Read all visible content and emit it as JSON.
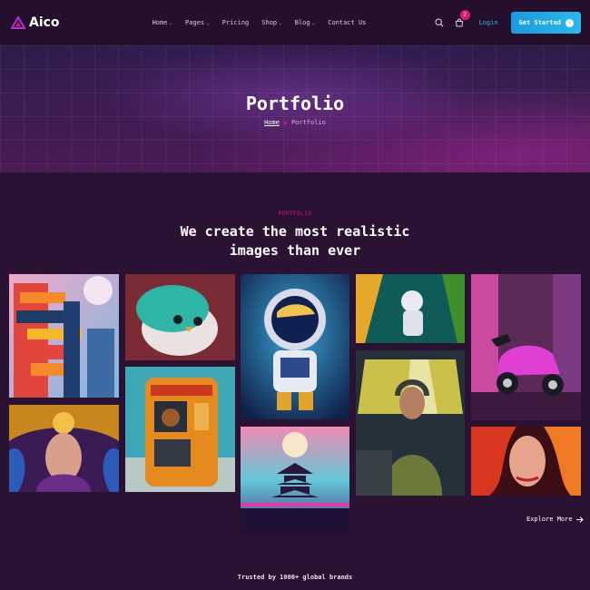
{
  "brand": {
    "name": "Aico"
  },
  "nav": {
    "items": [
      {
        "label": "Home",
        "has_dropdown": true
      },
      {
        "label": "Pages",
        "has_dropdown": true
      },
      {
        "label": "Pricing",
        "has_dropdown": false
      },
      {
        "label": "Shop",
        "has_dropdown": true
      },
      {
        "label": "Blog",
        "has_dropdown": true
      },
      {
        "label": "Contact Us",
        "has_dropdown": false
      }
    ]
  },
  "header": {
    "cart_count": "2",
    "login_label": "Login",
    "cta_label": "Get Started",
    "icons": [
      "search-icon",
      "cart-icon",
      "arrow-right-icon"
    ]
  },
  "hero": {
    "title": "Portfolio",
    "breadcrumb": {
      "home": "Home",
      "current": "Portfolio"
    }
  },
  "portfolio": {
    "eyebrow": "PORTFOLIO",
    "title": "We create the most realistic images than ever",
    "images": [
      "robot-building-illustration",
      "fluffy-bird-creature",
      "astronaut-toy-character",
      "astronaut-in-jungle",
      "pink-scooter",
      "golden-mask-woman-portrait",
      "teddy-bear-vending-machine",
      "pilot-woman-in-cockpit",
      "neon-pagoda-landscape",
      "fire-haired-woman-portrait"
    ],
    "explore_label": "Explore More"
  },
  "brands": {
    "trusted_label": "Trusted by 1000+ global brands"
  },
  "colors": {
    "accent_pink": "#e0157a",
    "accent_blue": "#29b9ea",
    "background": "#2a1233",
    "header_bg": "#24102c"
  }
}
